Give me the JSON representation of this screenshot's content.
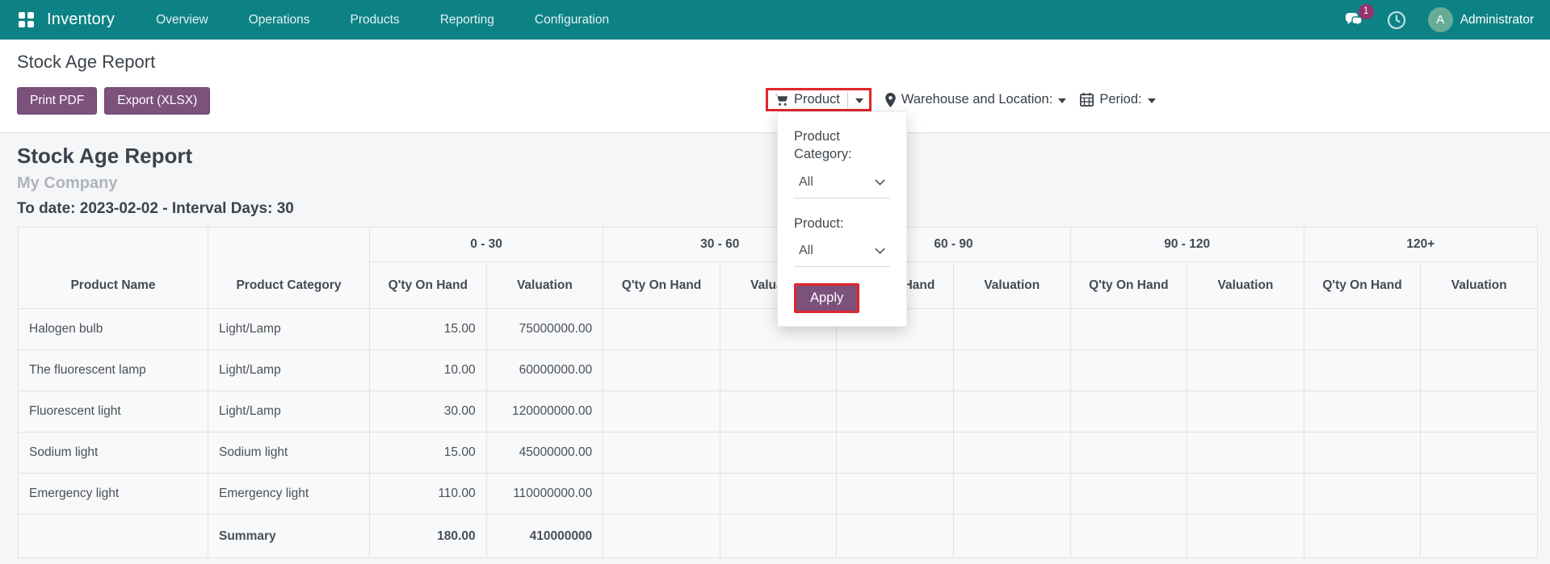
{
  "navbar": {
    "app_name": "Inventory",
    "menu": [
      "Overview",
      "Operations",
      "Products",
      "Reporting",
      "Configuration"
    ],
    "messages_badge": "1",
    "user": {
      "initial": "A",
      "name": "Administrator"
    }
  },
  "header": {
    "page_title": "Stock Age Report",
    "print_pdf_label": "Print PDF",
    "export_label": "Export (XLSX)",
    "filters": {
      "product_label": "Product",
      "warehouse_label": "Warehouse and Location:",
      "period_label": "Period:"
    },
    "product_dropdown": {
      "category_label": "Product Category:",
      "category_value": "All",
      "product_label": "Product:",
      "product_value": "All",
      "apply_label": "Apply"
    }
  },
  "report": {
    "title": "Stock Age Report",
    "company": "My Company",
    "subtitle": "To date: 2023-02-02 - Interval Days: 30"
  },
  "table": {
    "col_product_name": "Product Name",
    "col_product_category": "Product Category",
    "groups": [
      "0 - 30",
      "30 - 60",
      "60 - 90",
      "90 - 120",
      "120+"
    ],
    "sub_qty": "Q'ty On Hand",
    "sub_valuation": "Valuation",
    "rows": [
      {
        "name": "Halogen bulb",
        "category": "Light/Lamp",
        "qty_0_30": "15.00",
        "val_0_30": "75000000.00"
      },
      {
        "name": "The fluorescent lamp",
        "category": "Light/Lamp",
        "qty_0_30": "10.00",
        "val_0_30": "60000000.00"
      },
      {
        "name": "Fluorescent light",
        "category": "Light/Lamp",
        "qty_0_30": "30.00",
        "val_0_30": "120000000.00"
      },
      {
        "name": "Sodium light",
        "category": "Sodium light",
        "qty_0_30": "15.00",
        "val_0_30": "45000000.00"
      },
      {
        "name": "Emergency light",
        "category": "Emergency light",
        "qty_0_30": "110.00",
        "val_0_30": "110000000.00"
      }
    ],
    "summary": {
      "label": "Summary",
      "qty_0_30": "180.00",
      "val_0_30": "410000000"
    }
  },
  "colors": {
    "navbar_teal": "#0d8285",
    "button_purple": "#7c517c",
    "highlight_red": "#e0262d",
    "badge_magenta": "#96336f",
    "avatar_green": "#66ac97",
    "page_bg": "#f5f6f8",
    "cell_bg": "#f8f9fa",
    "border_gray": "#e0e2e5"
  }
}
